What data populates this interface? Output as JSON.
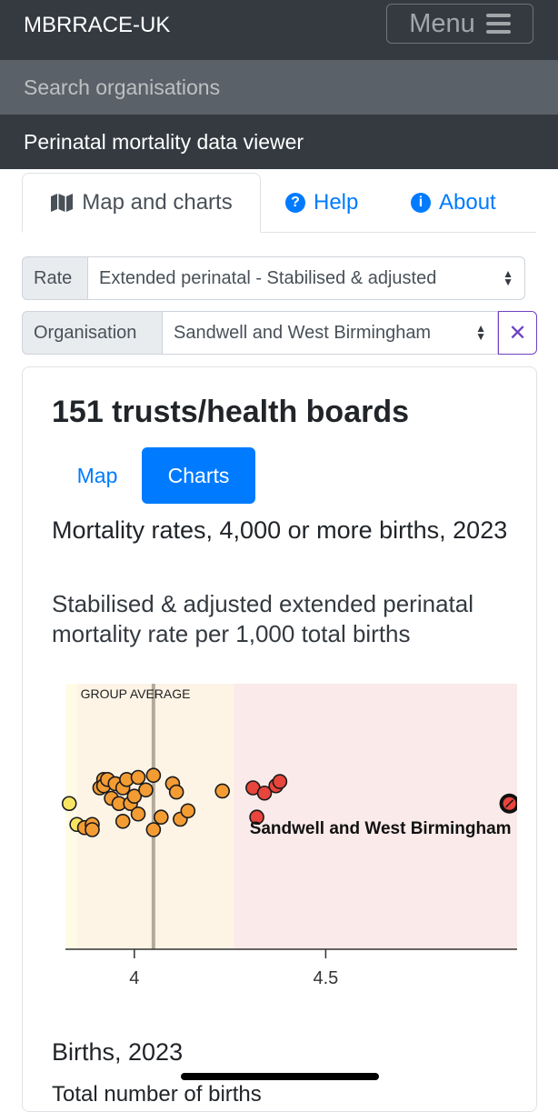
{
  "topbar": {
    "brand": "MBRRACE-UK",
    "menu_label": "Menu"
  },
  "nav": {
    "search": "Search organisations",
    "viewer": "Perinatal mortality data viewer"
  },
  "tabs": [
    {
      "label": "Map and charts",
      "icon": "map-icon"
    },
    {
      "label": "Help",
      "icon": "question-circle-icon"
    },
    {
      "label": "About",
      "icon": "info-circle-icon"
    }
  ],
  "filters": {
    "rate_label": "Rate",
    "rate_value": "Extended perinatal - Stabilised & adjusted",
    "org_label": "Organisation",
    "org_value": "Sandwell and West Birmingham",
    "clear_icon": "close-icon"
  },
  "card": {
    "title": "151 trusts/health boards",
    "view_map": "Map",
    "view_charts": "Charts",
    "chart_title": "Mortality rates, 4,000 or more births, 2023",
    "chart_subtitle": "Stabilised & adjusted extended perinatal mortality rate per 1,000 total births",
    "births_title": "Births, 2023",
    "births_subtitle": "Total number of births"
  },
  "chart_data": {
    "type": "scatter",
    "group_average_label": "GROUP AVERAGE",
    "group_average": 4.05,
    "xlim": [
      3.82,
      5.0
    ],
    "xticks": [
      4,
      4.5
    ],
    "bands": [
      {
        "from": 3.82,
        "to": 3.85,
        "color": "#fffbe6"
      },
      {
        "from": 3.85,
        "to": 4.26,
        "color": "#fdf4e6"
      },
      {
        "from": 4.26,
        "to": 5.0,
        "color": "#fbeaea"
      }
    ],
    "highlight": {
      "name": "Sandwell and West Birmingham",
      "x": 4.98
    },
    "series": [
      {
        "color": "#f7e463",
        "points": [
          [
            3.83,
            0.55
          ],
          [
            3.85,
            0.35
          ]
        ]
      },
      {
        "color": "#f39c34",
        "points": [
          [
            3.87,
            0.32
          ],
          [
            3.89,
            0.35
          ],
          [
            3.89,
            0.3
          ],
          [
            3.91,
            0.7
          ],
          [
            3.92,
            0.78
          ],
          [
            3.92,
            0.72
          ],
          [
            3.93,
            0.78
          ],
          [
            3.94,
            0.6
          ],
          [
            3.95,
            0.74
          ],
          [
            3.96,
            0.55
          ],
          [
            3.97,
            0.7
          ],
          [
            3.97,
            0.38
          ],
          [
            3.98,
            0.78
          ],
          [
            3.99,
            0.55
          ],
          [
            4.0,
            0.62
          ],
          [
            4.01,
            0.8
          ],
          [
            4.01,
            0.45
          ],
          [
            4.03,
            0.68
          ],
          [
            4.05,
            0.82
          ],
          [
            4.05,
            0.3
          ],
          [
            4.07,
            0.42
          ],
          [
            4.1,
            0.74
          ],
          [
            4.11,
            0.66
          ],
          [
            4.12,
            0.4
          ],
          [
            4.14,
            0.48
          ],
          [
            4.23,
            0.67
          ]
        ]
      },
      {
        "color": "#e8453c",
        "points": [
          [
            4.31,
            0.7
          ],
          [
            4.32,
            0.42
          ],
          [
            4.34,
            0.65
          ],
          [
            4.37,
            0.72
          ],
          [
            4.38,
            0.76
          ]
        ]
      }
    ]
  }
}
